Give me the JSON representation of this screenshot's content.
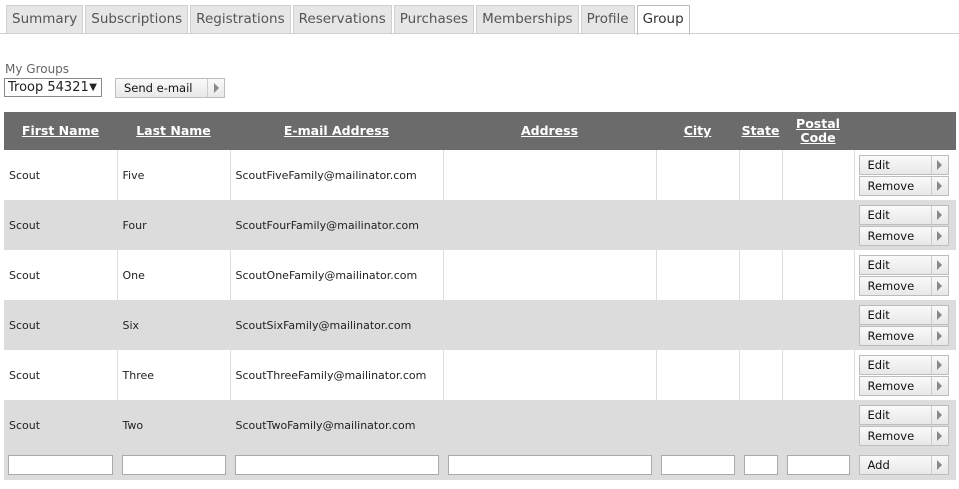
{
  "tabs": [
    "Summary",
    "Subscriptions",
    "Registrations",
    "Reservations",
    "Purchases",
    "Memberships",
    "Profile",
    "Group"
  ],
  "active_tab": "Group",
  "groups": {
    "label": "My Groups",
    "selected": "Troop 54321",
    "send_email_label": "Send e-mail"
  },
  "table": {
    "headers": {
      "first": "First Name",
      "last": "Last Name",
      "email": "E-mail Address",
      "address": "Address",
      "city": "City",
      "state": "State",
      "postal": "Postal Code"
    },
    "rows": [
      {
        "first": "Scout",
        "last": "Five",
        "email": "ScoutFiveFamily@mailinator.com",
        "address": "",
        "city": "",
        "state": "",
        "postal": ""
      },
      {
        "first": "Scout",
        "last": "Four",
        "email": "ScoutFourFamily@mailinator.com",
        "address": "",
        "city": "",
        "state": "",
        "postal": ""
      },
      {
        "first": "Scout",
        "last": "One",
        "email": "ScoutOneFamily@mailinator.com",
        "address": "",
        "city": "",
        "state": "",
        "postal": ""
      },
      {
        "first": "Scout",
        "last": "Six",
        "email": "ScoutSixFamily@mailinator.com",
        "address": "",
        "city": "",
        "state": "",
        "postal": ""
      },
      {
        "first": "Scout",
        "last": "Three",
        "email": "ScoutThreeFamily@mailinator.com",
        "address": "",
        "city": "",
        "state": "",
        "postal": ""
      },
      {
        "first": "Scout",
        "last": "Two",
        "email": "ScoutTwoFamily@mailinator.com",
        "address": "",
        "city": "",
        "state": "",
        "postal": ""
      }
    ],
    "edit_label": "Edit",
    "remove_label": "Remove",
    "add_label": "Add"
  }
}
